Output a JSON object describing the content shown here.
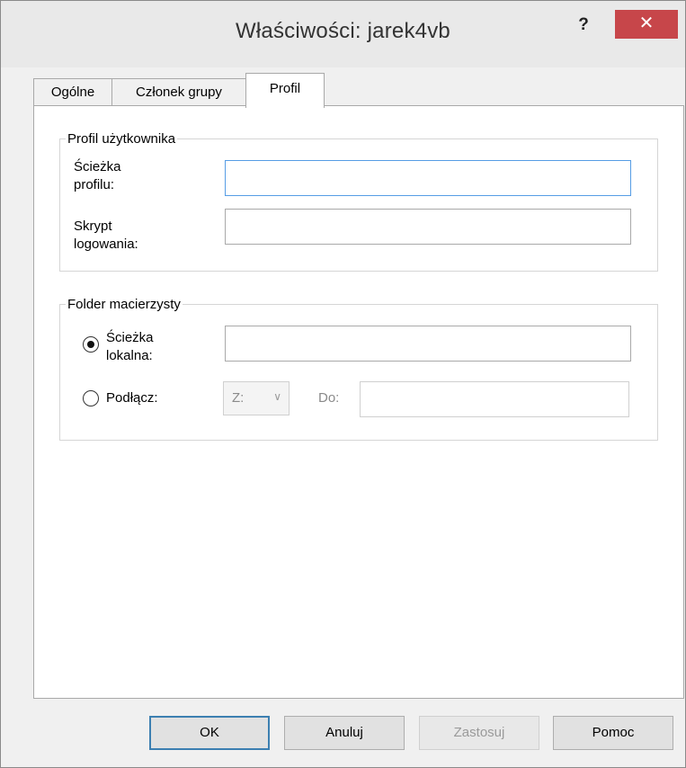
{
  "window": {
    "title": "Właściwości: jarek4vb",
    "help_label": "?",
    "close_label": "✕"
  },
  "tabs": [
    {
      "label": "Ogólne",
      "active": false
    },
    {
      "label": "Członek grupy",
      "active": false
    },
    {
      "label": "Profil",
      "active": true
    }
  ],
  "profile_group": {
    "title": "Profil użytkownika",
    "profile_path_label_line1": "Ścieżka",
    "profile_path_label_line2": "profilu:",
    "profile_path_value": "",
    "logon_script_label_line1": "Skrypt",
    "logon_script_label_line2": "logowania:",
    "logon_script_value": ""
  },
  "home_folder_group": {
    "title": "Folder macierzysty",
    "local_path_label_line1": "Ścieżka",
    "local_path_label_line2": "lokalna:",
    "local_path_selected": true,
    "local_path_value": "",
    "connect_label": "Podłącz:",
    "connect_selected": false,
    "drive_value": "Z:",
    "to_label": "Do:",
    "to_value": ""
  },
  "buttons": {
    "ok": "OK",
    "cancel": "Anuluj",
    "apply": "Zastosuj",
    "help": "Pomoc"
  },
  "colors": {
    "close_button": "#c7464a",
    "focus_border": "#569de5",
    "default_button_border": "#3c7fb1"
  }
}
